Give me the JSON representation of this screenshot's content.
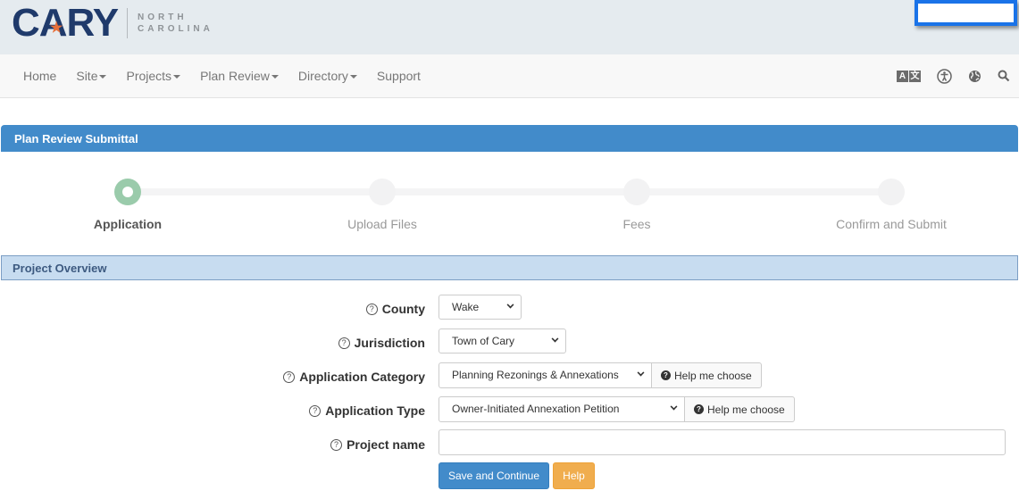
{
  "brand": {
    "logo_text": "CARY",
    "logo_state_line1": "NORTH",
    "logo_state_line2": "CAROLINA",
    "star_glyph": "★",
    "accent_star_color": "#e8703a",
    "logo_color": "#1f3a6b"
  },
  "nav": {
    "items": [
      {
        "label": "Home",
        "dropdown": false
      },
      {
        "label": "Site",
        "dropdown": true
      },
      {
        "label": "Projects",
        "dropdown": true
      },
      {
        "label": "Plan Review",
        "dropdown": true
      },
      {
        "label": "Directory",
        "dropdown": true
      },
      {
        "label": "Support",
        "dropdown": false
      }
    ],
    "icons": [
      {
        "name": "translate-icon",
        "glyph_a": "A",
        "glyph_b": "文"
      },
      {
        "name": "accessibility-icon",
        "glyph": "♿"
      },
      {
        "name": "globe-icon",
        "glyph": "🌐"
      },
      {
        "name": "search-icon",
        "glyph": "⚲"
      }
    ]
  },
  "panel": {
    "title": "Plan Review Submittal",
    "color": "#428bca"
  },
  "steps": [
    {
      "label": "Application",
      "active": true
    },
    {
      "label": "Upload Files",
      "active": false
    },
    {
      "label": "Fees",
      "active": false
    },
    {
      "label": "Confirm and Submit",
      "active": false
    }
  ],
  "section": {
    "title": "Project Overview"
  },
  "form": {
    "help_glyph": "?",
    "county": {
      "label": "County",
      "value": "Wake"
    },
    "jurisdiction": {
      "label": "Jurisdiction",
      "value": "Town of Cary"
    },
    "application_category": {
      "label": "Application Category",
      "value": "Planning Rezonings & Annexations",
      "help_button": "Help me choose"
    },
    "application_type": {
      "label": "Application Type",
      "value": "Owner-Initiated Annexation Petition",
      "help_button": "Help me choose"
    },
    "project_name": {
      "label": "Project name",
      "value": "",
      "placeholder": ""
    },
    "save_button": "Save and Continue",
    "help_button": "Help"
  }
}
